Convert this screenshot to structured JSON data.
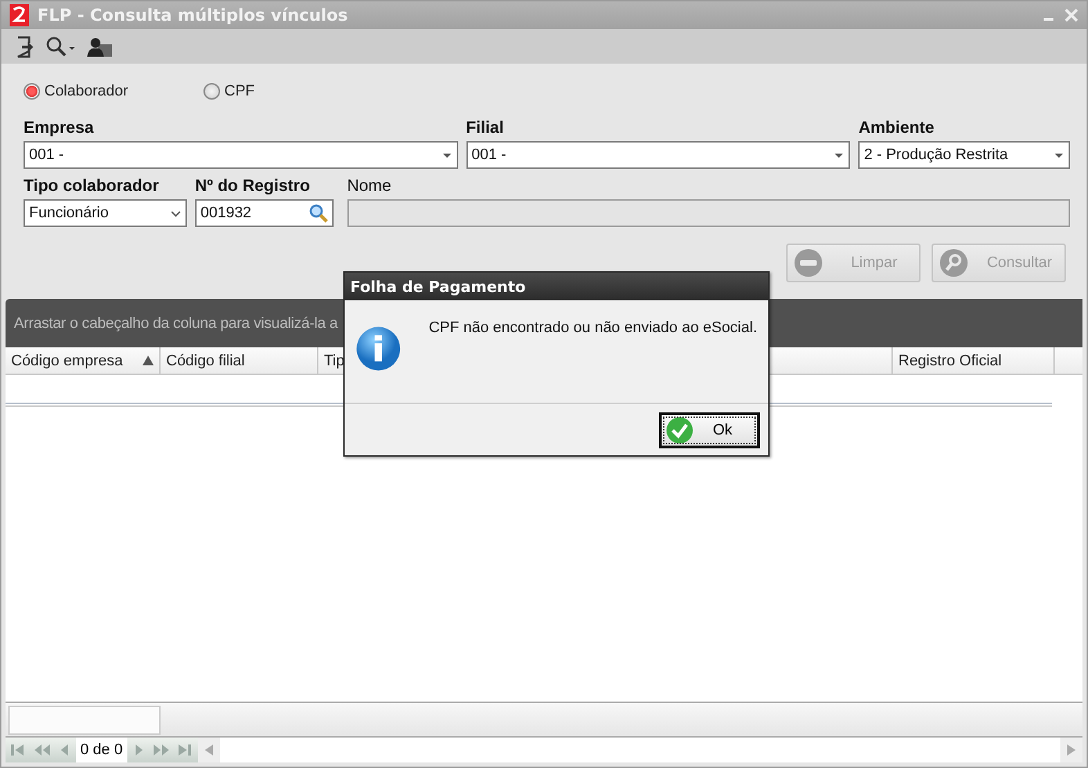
{
  "window": {
    "title": "FLP - Consulta múltiplos vínculos"
  },
  "search_modes": [
    {
      "label": "Colaborador",
      "selected": true
    },
    {
      "label": "CPF",
      "selected": false
    }
  ],
  "fields": {
    "empresa": {
      "label": "Empresa",
      "value": "001 -"
    },
    "filial": {
      "label": "Filial",
      "value": "001 -"
    },
    "ambiente": {
      "label": "Ambiente",
      "value": "2 - Produção Restrita"
    },
    "tipo_colaborador": {
      "label": "Tipo colaborador",
      "value": "Funcionário"
    },
    "registro": {
      "label": "Nº do Registro",
      "value": "001932"
    },
    "nome": {
      "label": "Nome",
      "disabled": true
    }
  },
  "actions": [
    {
      "kind": "clear",
      "label": "Limpar",
      "disabled": true
    },
    {
      "kind": "search",
      "label": "Consultar",
      "disabled": true
    }
  ],
  "grid": {
    "group_hint": "Arrastar o cabeçalho da coluna para visualizá-la a",
    "columns": [
      {
        "label": "Código empresa",
        "sorted": true
      },
      {
        "label": "Código filial",
        "sorted": false
      },
      {
        "label": "Tip",
        "sorted": false
      },
      {
        "label": "Registro Oficial",
        "sorted": false
      }
    ],
    "pager": "0 de 0"
  },
  "dialog": {
    "title": "Folha de Pagamento",
    "message": "CPF não encontrado ou não enviado ao eSocial.",
    "button": "Ok"
  }
}
